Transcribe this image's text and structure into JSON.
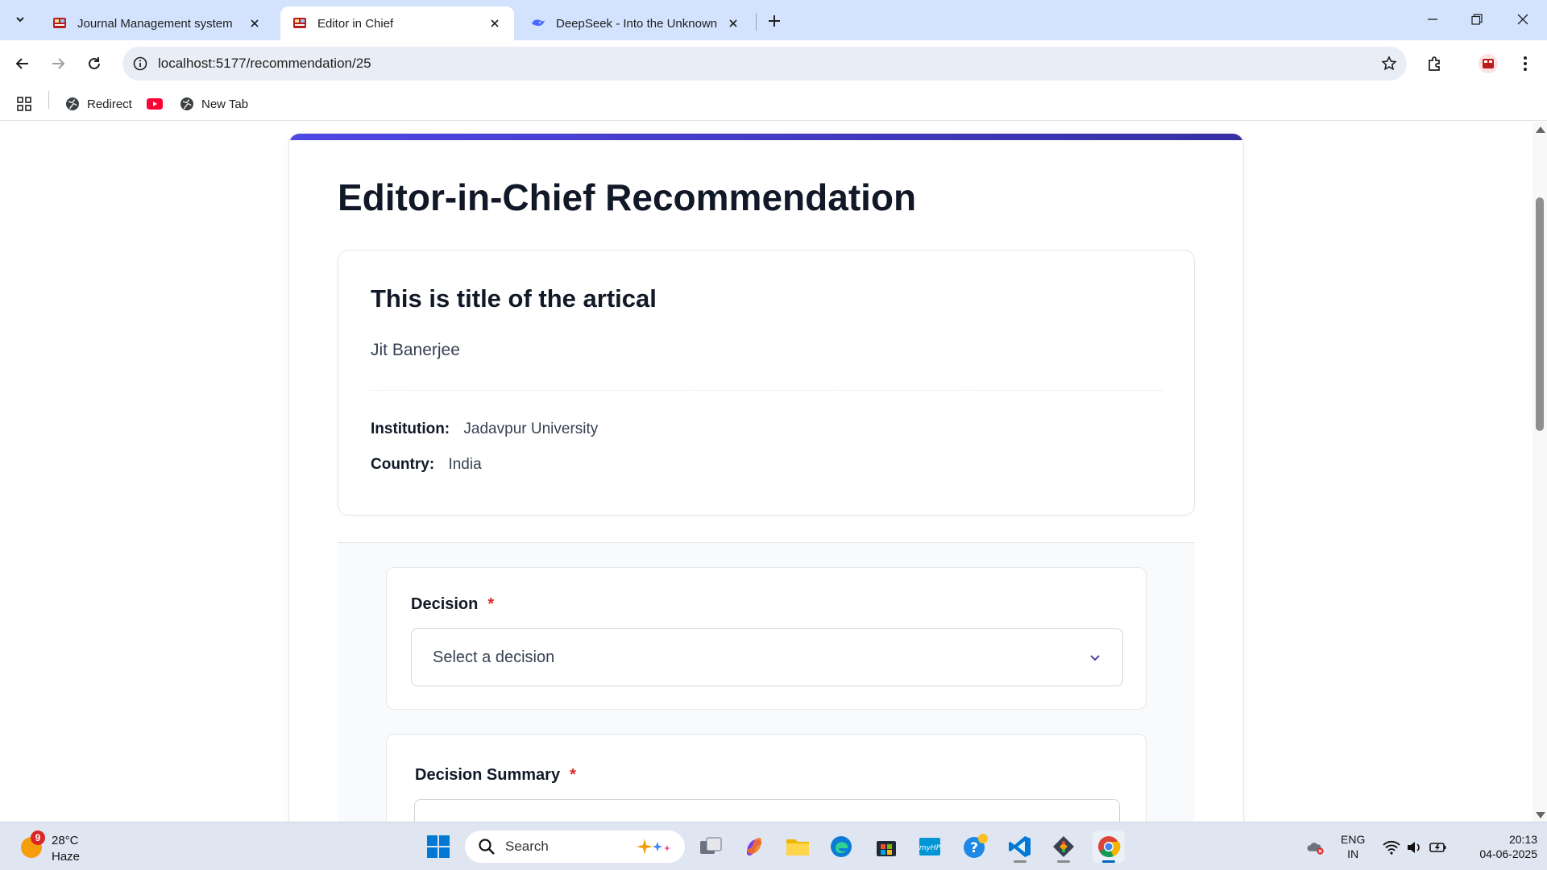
{
  "browser": {
    "tabs": [
      {
        "title": "Journal Management system",
        "favicon": "journal-favicon-icon",
        "active": false
      },
      {
        "title": "Editor in Chief",
        "favicon": "journal-favicon-icon",
        "active": true
      },
      {
        "title": "DeepSeek - Into the Unknown",
        "favicon": "deepseek-whale-icon",
        "active": false
      }
    ],
    "url": "localhost:5177/recommendation/25",
    "bookmarks": [
      {
        "label": "Redirect",
        "icon": "globe-icon"
      },
      {
        "label": "",
        "icon": "youtube-icon"
      },
      {
        "label": "New Tab",
        "icon": "globe-icon"
      }
    ]
  },
  "page": {
    "title": "Editor-in-Chief Recommendation",
    "accent_color": "#4f46e5",
    "article": {
      "title": "This is title of the artical",
      "author": "Jit Banerjee",
      "institution_label": "Institution:",
      "institution": "Jadavpur University",
      "country_label": "Country:",
      "country": "India"
    },
    "form": {
      "decision_label": "Decision",
      "decision_required": "*",
      "decision_placeholder": "Select a decision",
      "summary_label": "Decision Summary",
      "summary_required": "*"
    }
  },
  "taskbar": {
    "weather_temp": "28°C",
    "weather_condition": "Haze",
    "weather_badge": "9",
    "search_placeholder": "Search",
    "lang_top": "ENG",
    "lang_bottom": "IN",
    "time": "20:13",
    "date": "04-06-2025"
  }
}
